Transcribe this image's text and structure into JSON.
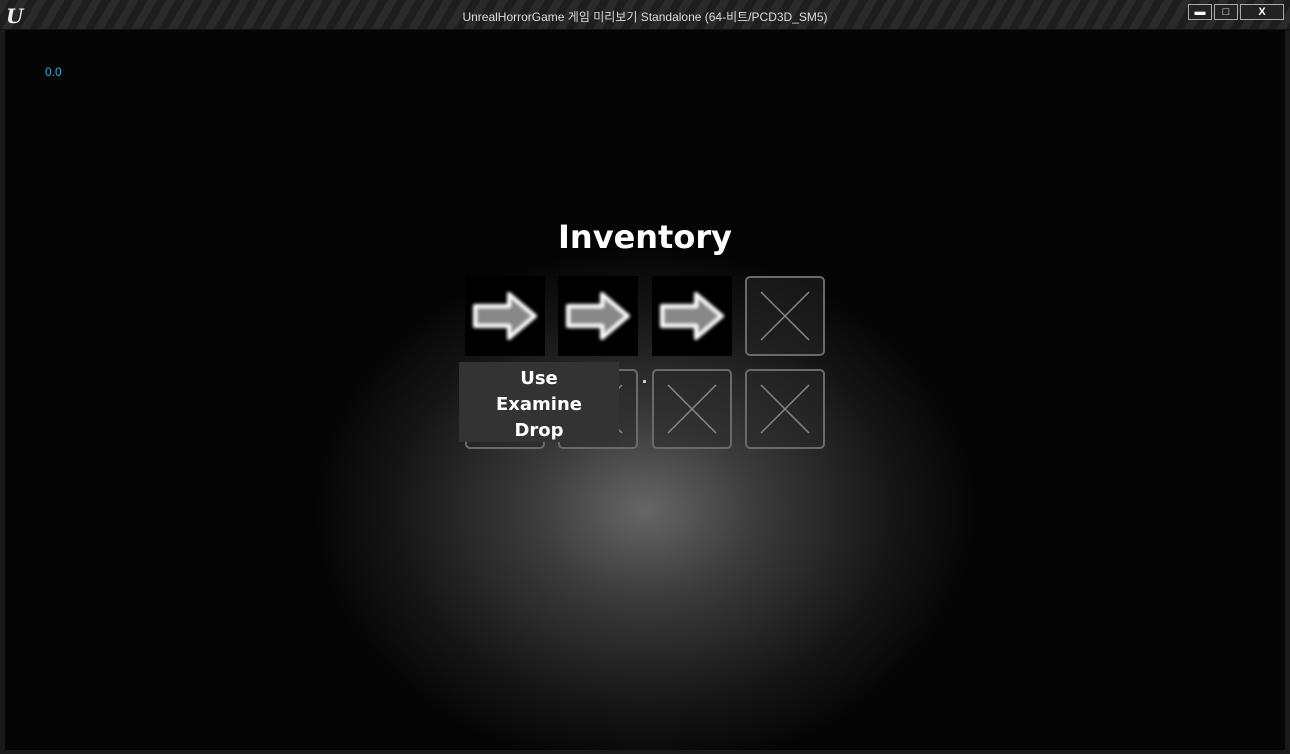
{
  "window": {
    "title": "UnrealHorrorGame 게임 미리보기 Standalone (64-비트/PCD3D_SM5)",
    "logo": "U",
    "minimize": "▬",
    "maximize": "□",
    "close": "X"
  },
  "hud": {
    "fps": "0.0"
  },
  "inventory": {
    "title": "Inventory",
    "slots": [
      {
        "state": "item",
        "icon": "arrow-right-icon"
      },
      {
        "state": "item",
        "icon": "arrow-right-icon"
      },
      {
        "state": "item",
        "icon": "arrow-right-icon"
      },
      {
        "state": "empty",
        "icon": "x-icon"
      },
      {
        "state": "empty",
        "icon": "x-icon"
      },
      {
        "state": "empty",
        "icon": "x-icon"
      },
      {
        "state": "empty",
        "icon": "x-icon"
      },
      {
        "state": "empty",
        "icon": "x-icon"
      }
    ],
    "context_menu": [
      "Use",
      "Examine",
      "Drop"
    ]
  }
}
